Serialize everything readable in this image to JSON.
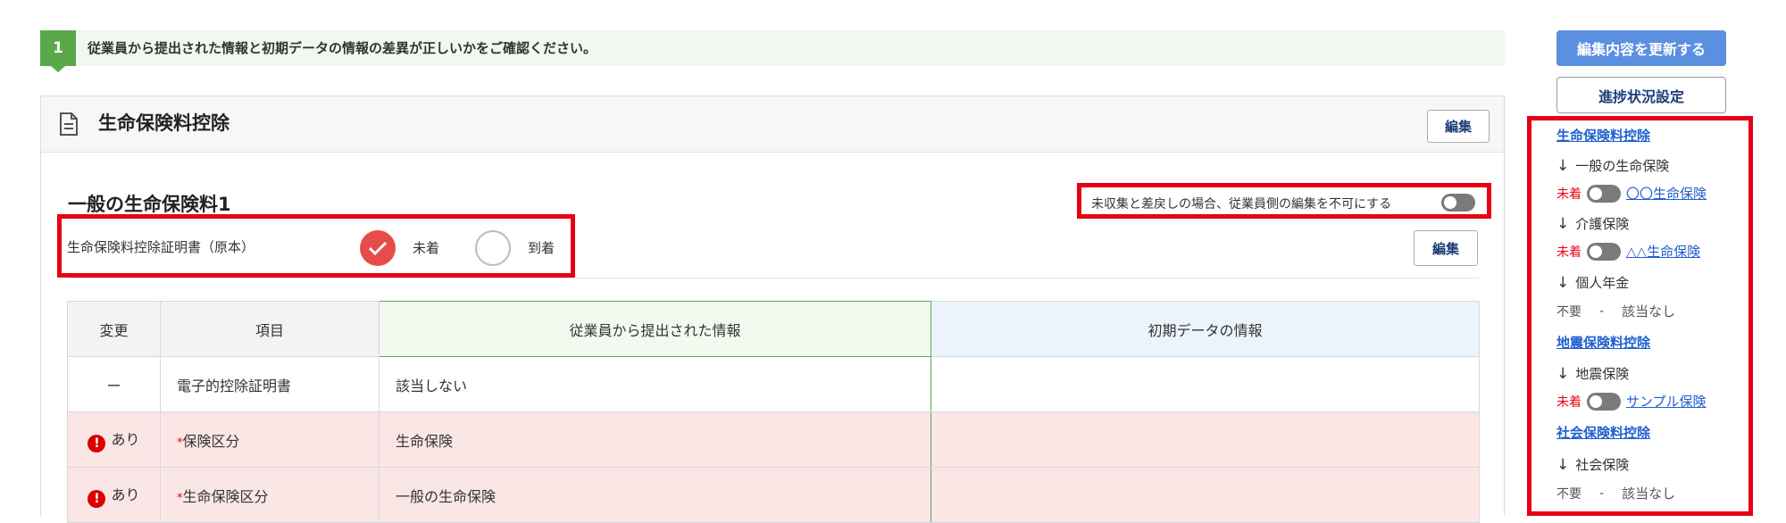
{
  "step": {
    "number": "1",
    "text": "従業員から提出された情報と初期データの情報の差異が正しいかをご確認ください。"
  },
  "card": {
    "title": "生命保険料控除",
    "edit_label": "編集",
    "section_title": "一般の生命保険料1",
    "lock_toggle_label": "未収集と差戻しの場合、従業員側の編集を不可にする",
    "certificate_label": "生命保険料控除証明書（原本）",
    "radio_not_arrived": "未着",
    "radio_arrived": "到着",
    "section_edit_label": "編集"
  },
  "table": {
    "headers": [
      "変更",
      "項目",
      "従業員から提出された情報",
      "初期データの情報"
    ],
    "rows": [
      {
        "change": "ー",
        "item": "電子的控除証明書",
        "employee": "該当しない",
        "initial": "",
        "diff": false,
        "required": false
      },
      {
        "change": "あり",
        "item": "保険区分",
        "employee": "生命保険",
        "initial": "",
        "diff": true,
        "required": true
      },
      {
        "change": "あり",
        "item": "生命保険区分",
        "employee": "一般の生命保険",
        "initial": "",
        "diff": true,
        "required": true
      }
    ]
  },
  "sidebar": {
    "update_button": "編集内容を更新する",
    "progress_button": "進捗状況設定",
    "sections": [
      {
        "title": "生命保険料控除"
      },
      {
        "sub": "一般の生命保険",
        "status": "未着",
        "link": "〇〇生命保険"
      },
      {
        "sub": "介護保険",
        "status": "未着",
        "link": "△△生命保険"
      },
      {
        "sub": "個人年金",
        "status": "不要",
        "dash": "-",
        "note": "該当なし"
      },
      {
        "title": "地震保険料控除"
      },
      {
        "sub": "地震保険",
        "status": "未着",
        "link": "サンプル保険"
      },
      {
        "title": "社会保険料控除"
      },
      {
        "sub": "社会保険",
        "status": "不要",
        "dash": "-",
        "note": "該当なし"
      }
    ]
  },
  "colors": {
    "accent_green": "#5aa84a",
    "highlight_red": "#e60012",
    "link_blue": "#1f5fcf",
    "button_blue": "#5b8fe0"
  }
}
